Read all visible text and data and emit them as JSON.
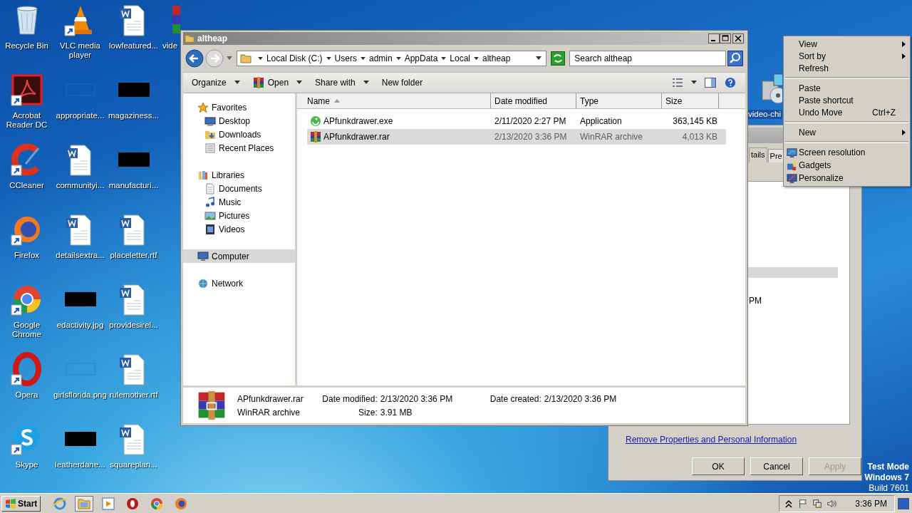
{
  "desktop": {
    "icons": [
      {
        "label": "Recycle Bin",
        "kind": "recycle",
        "shortcut": false
      },
      {
        "label": "Acrobat Reader DC",
        "kind": "acrobat",
        "shortcut": true
      },
      {
        "label": "CCleaner",
        "kind": "ccleaner",
        "shortcut": true
      },
      {
        "label": "Firefox",
        "kind": "firefox",
        "shortcut": true
      },
      {
        "label": "Google Chrome",
        "kind": "chrome",
        "shortcut": true
      },
      {
        "label": "Opera",
        "kind": "opera",
        "shortcut": true
      },
      {
        "label": "Skype",
        "kind": "skype",
        "shortcut": true
      },
      {
        "label": "VLC media player",
        "kind": "vlc",
        "shortcut": true
      },
      {
        "label": "appropriate...",
        "kind": "blank",
        "shortcut": false
      },
      {
        "label": "communityi...",
        "kind": "word",
        "shortcut": false
      },
      {
        "label": "detailsextra...",
        "kind": "word",
        "shortcut": false
      },
      {
        "label": "edactivity.jpg",
        "kind": "black",
        "shortcut": false
      },
      {
        "label": "girlsflorida.png",
        "kind": "blank",
        "shortcut": false
      },
      {
        "label": "leatherdane...",
        "kind": "black",
        "shortcut": false
      },
      {
        "label": "lowfeatured...",
        "kind": "word",
        "shortcut": false
      },
      {
        "label": "magaziness...",
        "kind": "black",
        "shortcut": false
      },
      {
        "label": "manufacturi...",
        "kind": "black",
        "shortcut": false
      },
      {
        "label": "placeletter.rtf",
        "kind": "word",
        "shortcut": false
      },
      {
        "label": "providesirel...",
        "kind": "word",
        "shortcut": false
      },
      {
        "label": "rulemother.rtf",
        "kind": "word",
        "shortcut": false
      },
      {
        "label": "squareplan...",
        "kind": "word",
        "shortcut": false
      }
    ],
    "partial_icon": {
      "label": "vide",
      "kind": "rar"
    },
    "right_icon": {
      "label": "video-chi",
      "kind": "setup"
    }
  },
  "properties_dialog": {
    "tabs": [
      {
        "label": "tails",
        "selected": true
      },
      {
        "label": "Pre",
        "selected": false
      }
    ],
    "time_fragment": "PM",
    "link": "Remove Properties and Personal Information",
    "buttons": [
      {
        "label": "OK",
        "disabled": false
      },
      {
        "label": "Cancel",
        "disabled": false
      },
      {
        "label": "Apply",
        "disabled": true
      }
    ]
  },
  "explorer": {
    "title": "altheap",
    "breadcrumb": [
      "Local Disk (C:)",
      "Users",
      "admin",
      "AppData",
      "Local",
      "altheap"
    ],
    "search": {
      "placeholder": "Search altheap"
    },
    "toolbar": [
      {
        "label": "Organize",
        "dropdown": true,
        "kind": "plain"
      },
      {
        "label": "Open",
        "dropdown": true,
        "kind": "rar"
      },
      {
        "label": "Share with",
        "dropdown": true,
        "kind": "plain"
      },
      {
        "label": "New folder",
        "dropdown": false,
        "kind": "plain"
      }
    ],
    "nav": [
      {
        "label": "Favorites",
        "kind": "star",
        "selected": false,
        "children": [
          {
            "label": "Desktop",
            "kind": "desktop",
            "selected": false
          },
          {
            "label": "Downloads",
            "kind": "downloads",
            "selected": false
          },
          {
            "label": "Recent Places",
            "kind": "recent",
            "selected": false
          }
        ]
      },
      {
        "label": "Libraries",
        "kind": "library",
        "selected": false,
        "children": [
          {
            "label": "Documents",
            "kind": "documents",
            "selected": false
          },
          {
            "label": "Music",
            "kind": "music",
            "selected": false
          },
          {
            "label": "Pictures",
            "kind": "pictures",
            "selected": false
          },
          {
            "label": "Videos",
            "kind": "videos",
            "selected": false
          }
        ]
      },
      {
        "label": "Computer",
        "kind": "computer",
        "selected": true
      },
      {
        "label": "Network",
        "kind": "network",
        "selected": false
      }
    ],
    "columns": [
      {
        "label": "Name",
        "sorted": true
      },
      {
        "label": "Date modified",
        "sorted": false
      },
      {
        "label": "Type",
        "sorted": false
      },
      {
        "label": "Size",
        "sorted": false
      }
    ],
    "rows": [
      {
        "kind": "exe",
        "name": "APfunkdrawer.exe",
        "date": "2/11/2020 2:27 PM",
        "type": "Application",
        "size": "363,145 KB",
        "selected": false
      },
      {
        "kind": "rar",
        "name": "APfunkdrawer.rar",
        "date": "2/13/2020 3:36 PM",
        "type": "WinRAR archive",
        "size": "4,013 KB",
        "selected": true
      }
    ],
    "details": {
      "kind": "rar",
      "name": "APfunkdrawer.rar",
      "type": "WinRAR archive",
      "fields": [
        {
          "label": "Date modified:",
          "value": "2/13/2020 3:36 PM"
        },
        {
          "label": "Size:",
          "value": "3.91 MB"
        },
        {
          "label": "Date created:",
          "value": "2/13/2020 3:36 PM"
        }
      ]
    }
  },
  "context_menu": {
    "items": [
      {
        "kind": "item",
        "label": "View",
        "submenu": true
      },
      {
        "kind": "item",
        "label": "Sort by",
        "submenu": true
      },
      {
        "kind": "item",
        "label": "Refresh",
        "submenu": false
      },
      {
        "kind": "separator"
      },
      {
        "kind": "item",
        "label": "Paste",
        "submenu": false
      },
      {
        "kind": "item",
        "label": "Paste shortcut",
        "submenu": false
      },
      {
        "kind": "item",
        "label": "Undo Move",
        "submenu": false,
        "shortcut": "Ctrl+Z"
      },
      {
        "kind": "separator"
      },
      {
        "kind": "item",
        "label": "New",
        "submenu": true
      },
      {
        "kind": "separator"
      },
      {
        "kind": "icon_item",
        "label": "Screen resolution",
        "submenu": false
      },
      {
        "kind": "icon_item",
        "label": "Gadgets",
        "submenu": false
      },
      {
        "kind": "icon_item",
        "label": "Personalize",
        "submenu": false
      }
    ]
  },
  "test_mode": [
    "Test Mode",
    "Windows 7",
    "Build 7601"
  ],
  "taskbar": {
    "start": "Start",
    "apps": [
      {
        "kind": "ie",
        "active": false
      },
      {
        "kind": "folder",
        "active": true
      },
      {
        "kind": "media",
        "active": false
      },
      {
        "kind": "opera",
        "active": false
      },
      {
        "kind": "chrome",
        "active": false
      },
      {
        "kind": "firefox",
        "active": false
      }
    ],
    "time": "3:36 PM"
  }
}
